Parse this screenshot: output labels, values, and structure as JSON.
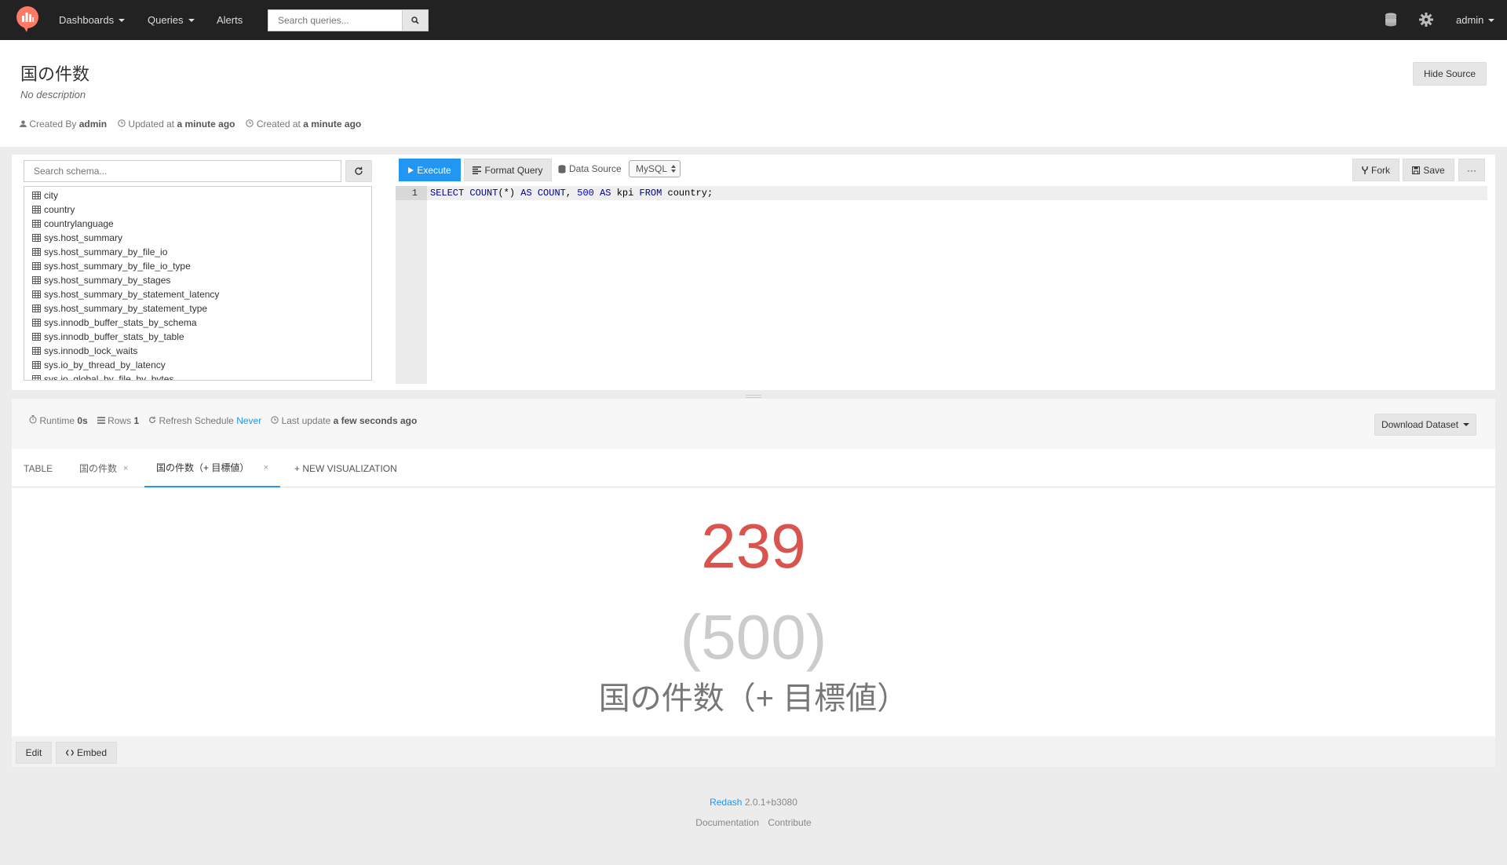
{
  "navbar": {
    "dashboards": "Dashboards",
    "queries": "Queries",
    "alerts": "Alerts",
    "search_placeholder": "Search queries...",
    "user": "admin"
  },
  "query": {
    "title": "国の件数",
    "description": "No description",
    "created_by_label": "Created By",
    "created_by": "admin",
    "updated_label": "Updated at",
    "updated": "a minute ago",
    "created_label": "Created at",
    "created": "a minute ago",
    "hide_source": "Hide Source"
  },
  "schema": {
    "search_placeholder": "Search schema...",
    "tables": [
      "city",
      "country",
      "countrylanguage",
      "sys.host_summary",
      "sys.host_summary_by_file_io",
      "sys.host_summary_by_file_io_type",
      "sys.host_summary_by_stages",
      "sys.host_summary_by_statement_latency",
      "sys.host_summary_by_statement_type",
      "sys.innodb_buffer_stats_by_schema",
      "sys.innodb_buffer_stats_by_table",
      "sys.innodb_lock_waits",
      "sys.io_by_thread_by_latency",
      "sys.io_global_by_file_by_bytes"
    ]
  },
  "toolbar": {
    "execute": "Execute",
    "format_query": "Format Query",
    "data_source_label": "Data Source",
    "data_source_value": "MySQL",
    "fork": "Fork",
    "save": "Save",
    "more": "···"
  },
  "editor": {
    "line_number": "1",
    "tokens": [
      {
        "t": "SELECT",
        "c": "kw"
      },
      {
        "t": " ",
        "c": ""
      },
      {
        "t": "COUNT",
        "c": "kw"
      },
      {
        "t": "(*) ",
        "c": ""
      },
      {
        "t": "AS",
        "c": "kw"
      },
      {
        "t": " ",
        "c": ""
      },
      {
        "t": "COUNT",
        "c": "kw"
      },
      {
        "t": ", ",
        "c": ""
      },
      {
        "t": "500",
        "c": "num"
      },
      {
        "t": " ",
        "c": ""
      },
      {
        "t": "AS",
        "c": "kw"
      },
      {
        "t": " kpi ",
        "c": ""
      },
      {
        "t": "FROM",
        "c": "kw"
      },
      {
        "t": " country;",
        "c": ""
      }
    ]
  },
  "results": {
    "runtime_label": "Runtime",
    "runtime": "0s",
    "rows_label": "Rows",
    "rows": "1",
    "refresh_label": "Refresh Schedule",
    "refresh": "Never",
    "last_update_label": "Last update",
    "last_update": "a few seconds ago",
    "download": "Download Dataset"
  },
  "tabs": {
    "table": "TABLE",
    "viz1": "国の件数",
    "viz2": "国の件数（+ 目標値）",
    "close": "×",
    "new_viz": "+ NEW VISUALIZATION"
  },
  "counter": {
    "value": "239",
    "target": "(500)",
    "name": "国の件数（+ 目標値）"
  },
  "viz_footer": {
    "edit": "Edit",
    "embed": "Embed"
  },
  "footer": {
    "brand": "Redash",
    "version": "2.0.1+b3080",
    "documentation": "Documentation",
    "contribute": "Contribute"
  },
  "colors": {
    "accent": "#2196f3",
    "counter_value": "#d9534f",
    "navbar": "#222222"
  }
}
